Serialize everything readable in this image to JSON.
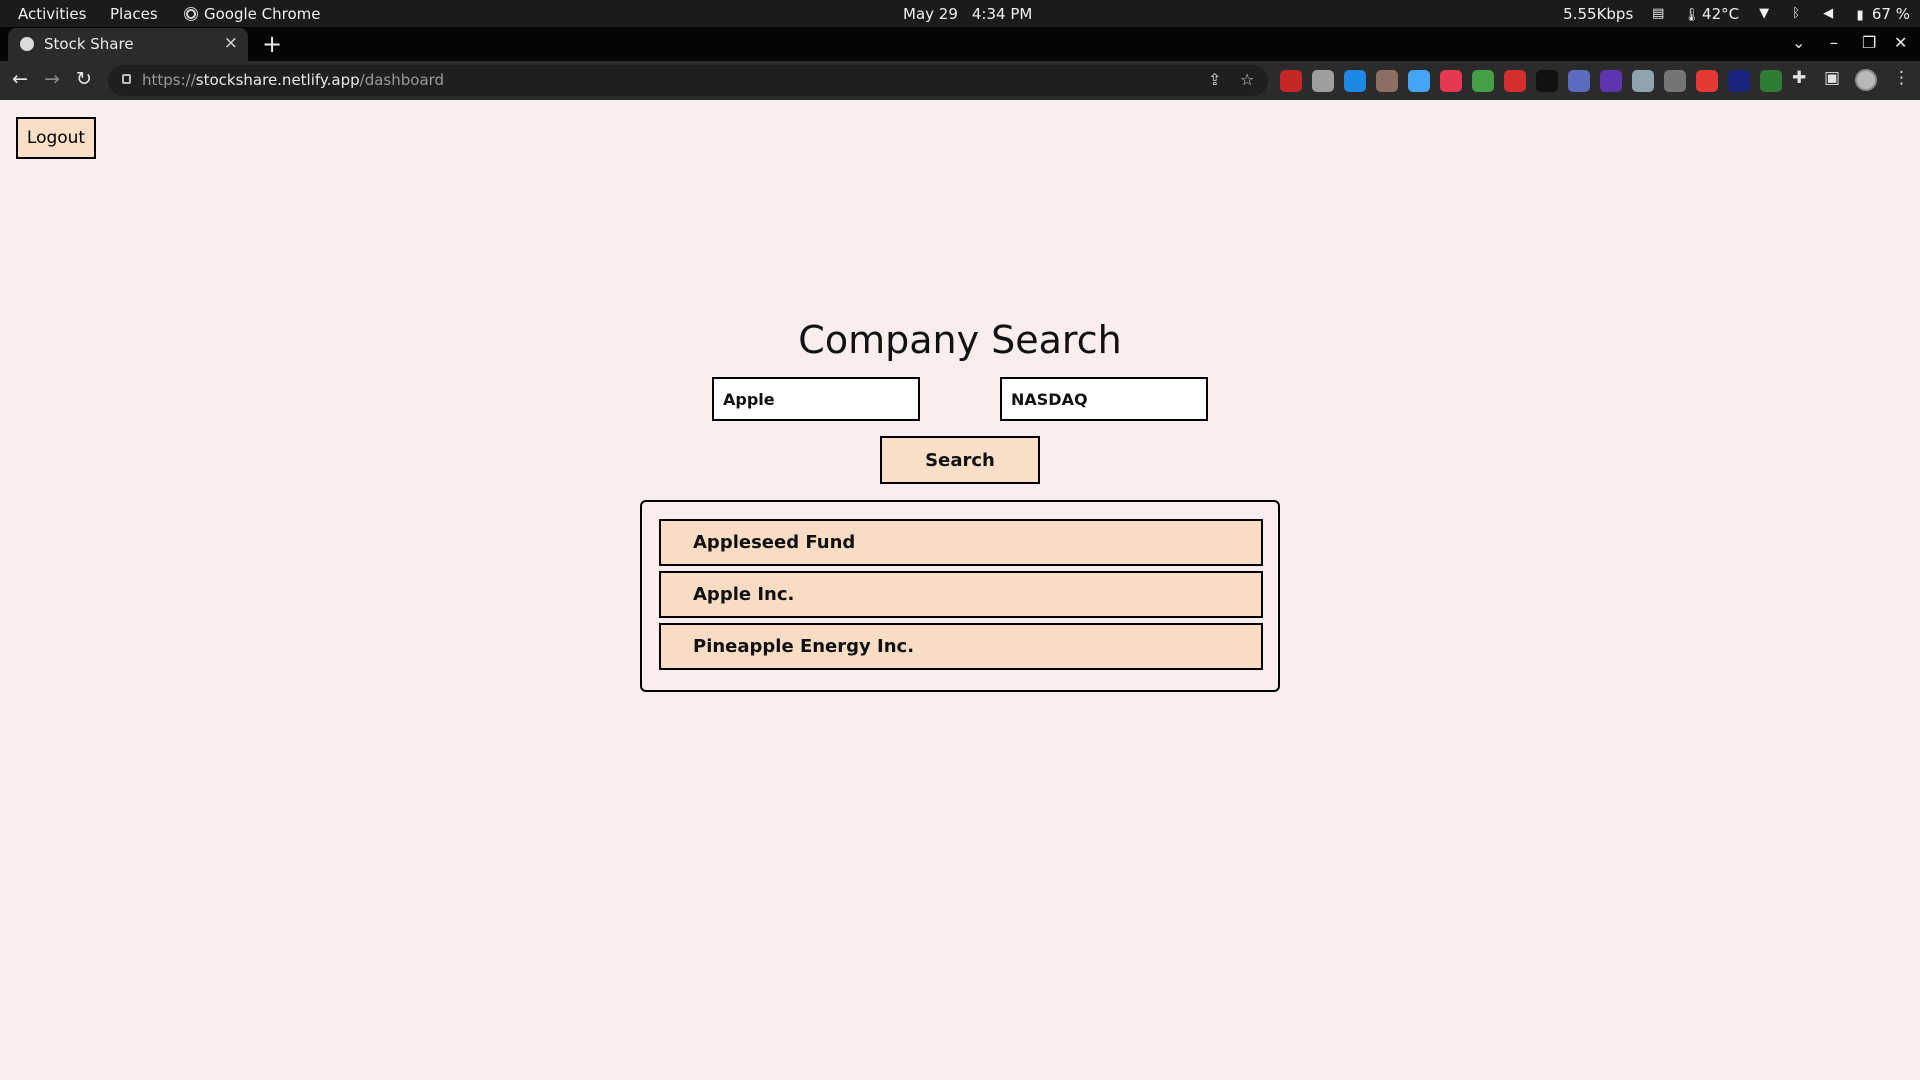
{
  "system_bar": {
    "activities": "Activities",
    "places": "Places",
    "app_name": "Google Chrome",
    "date": "May 29",
    "time": "4:34 PM",
    "network_speed": "5.55Kbps",
    "temperature": "42°C",
    "battery": "67 %"
  },
  "browser": {
    "tab_title": "Stock Share",
    "url_scheme": "https://",
    "url_host": "stockshare.netlify.app",
    "url_path": "/dashboard",
    "extension_colors": [
      "#c62828",
      "#9e9e9e",
      "#1e88e5",
      "#8d6e63",
      "#42a5f5",
      "#e53950",
      "#43a047",
      "#d32f2f",
      "#111111",
      "#5c6bc0",
      "#5e35b1",
      "#90a4ae",
      "#757575",
      "#e53935",
      "#1a237e",
      "#2e7d32"
    ]
  },
  "page": {
    "logout_label": "Logout",
    "heading": "Company Search",
    "company_value": "Apple",
    "exchange_value": "NASDAQ",
    "search_label": "Search",
    "results": [
      "Appleseed Fund",
      "Apple Inc.",
      "Pineapple Energy Inc."
    ]
  },
  "colors": {
    "page_background": "#f9eded",
    "button_fill": "#f9dec8",
    "result_fill": "#f9dcc4",
    "border": "#000000"
  }
}
